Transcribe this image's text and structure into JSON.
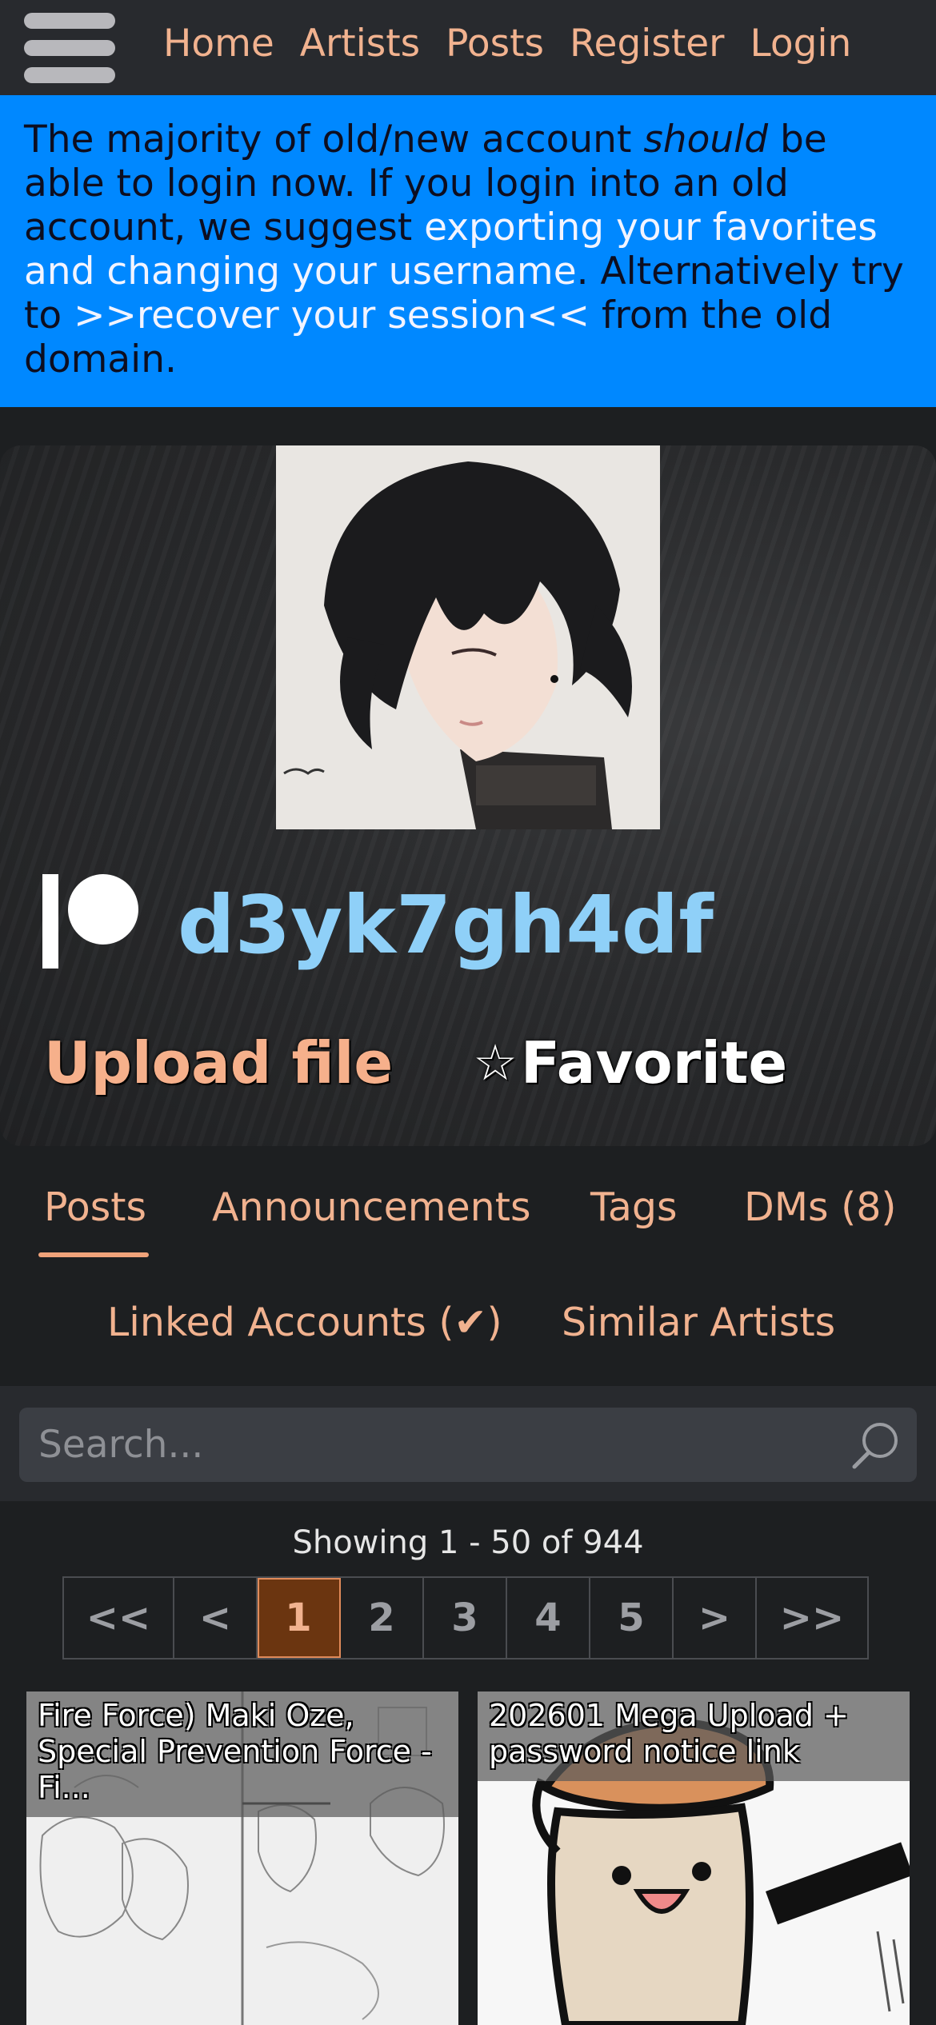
{
  "nav": {
    "links": [
      "Home",
      "Artists",
      "Posts",
      "Register",
      "Login"
    ]
  },
  "banner": {
    "part1": "The majority of old/new account ",
    "emphasis": "should",
    "part2": " be able to login now. If you login into an old account, we suggest ",
    "link1": "exporting your favorites and changing your username",
    "part3": ". Alternatively try to ",
    "link2": ">>recover your session<<",
    "part4": " from the old domain."
  },
  "artist": {
    "name": "d3yk7gh4df",
    "service_icon": "patreon-icon",
    "upload_label": "Upload file",
    "favorite_star": "☆",
    "favorite_label": "Favorite"
  },
  "tabs": {
    "posts": "Posts",
    "announcements": "Announcements",
    "tags": "Tags",
    "dms": "DMs (8)",
    "linked": "Linked Accounts (✔)",
    "similar": "Similar Artists",
    "active": "Posts"
  },
  "search": {
    "placeholder": "Search..."
  },
  "pagination": {
    "summary": "Showing 1 - 50 of 944",
    "items": [
      "<<",
      "<",
      "1",
      "2",
      "3",
      "4",
      "5",
      ">",
      ">>"
    ],
    "current": "1"
  },
  "posts": [
    {
      "title": "Fire Force) Maki Oze, Special Prevention Force - Fi..."
    },
    {
      "title": "202601 Mega Upload + password notice link"
    }
  ],
  "colors": {
    "accent": "#e8a17a",
    "banner": "#0088ff",
    "artist_name": "#8fd0f8",
    "active_page": "#6b3510"
  }
}
